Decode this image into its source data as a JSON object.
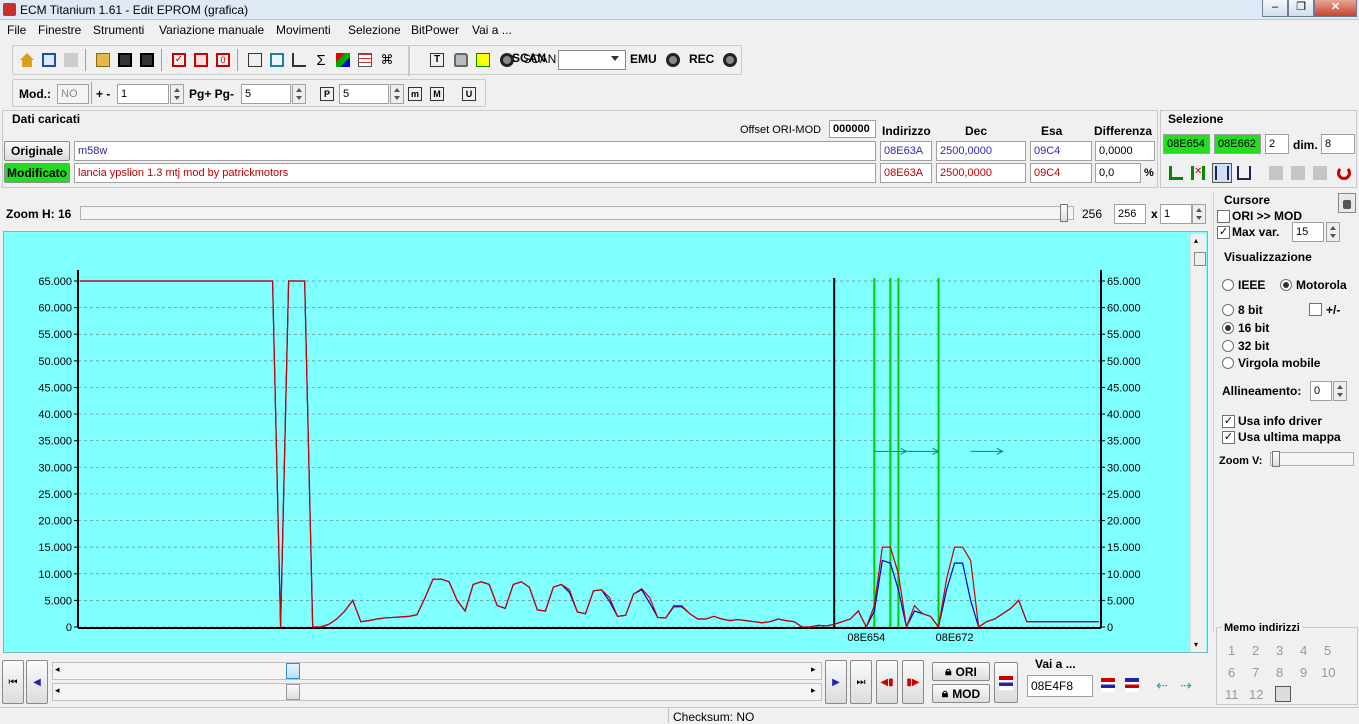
{
  "window": {
    "title": "ECM Titanium 1.61 - Edit EPROM (grafica)"
  },
  "menu": [
    "File",
    "Finestre",
    "Strumenti",
    "Variazione manuale",
    "Movimenti",
    "Selezione",
    "BitPower",
    "Vai a ..."
  ],
  "toolbar1": {
    "scan_label": "SCAN",
    "scan_value": "",
    "emu_label": "EMU",
    "rec_label": "REC"
  },
  "toolbar2": {
    "mod_label": "Mod.:",
    "mod_value": "NO",
    "plusminus_label": "+ -",
    "plusminus_value": "1",
    "pg_label": "Pg+ Pg-",
    "pg_value": "5",
    "p_value": "5"
  },
  "dati": {
    "title": "Dati caricati",
    "offset_label": "Offset ORI-MOD",
    "offset_value": "000000",
    "col_indirizzo": "Indirizzo",
    "col_dec": "Dec",
    "col_esa": "Esa",
    "col_diff": "Differenza",
    "originale_label": "Originale",
    "originale_name": "m58w",
    "originale_addr": "08E63A",
    "originale_dec": "2500,0000",
    "originale_esa": "09C4",
    "originale_diff": "0,0000",
    "modificato_label": "Modificato",
    "modificato_name": "lancia ypslion 1.3 mtj mod by patrickmotors",
    "modificato_addr": "08E63A",
    "modificato_dec": "2500,0000",
    "modificato_esa": "09C4",
    "modificato_diff": "0,0",
    "percent": "%"
  },
  "selezione": {
    "title": "Selezione",
    "start": "08E654",
    "end": "08E662",
    "count": "2",
    "dim_label": "dim.",
    "dim_value": "8"
  },
  "zoom": {
    "label": "Zoom H: 16",
    "value_a": "256",
    "value_b": "256",
    "x_label": "x",
    "mult": "1",
    "slider_fraction": 0.995
  },
  "cursore": {
    "title": "Cursore",
    "ori_mod_label": "ORI >> MOD",
    "ori_mod_checked": false,
    "maxvar_label": "Max var.",
    "maxvar_checked": true,
    "maxvar_value": "15"
  },
  "visualizzazione": {
    "title": "Visualizzazione",
    "ieee": "IEEE",
    "motorola": "Motorola",
    "bit8": "8 bit",
    "bit16": "16 bit",
    "bit32": "32 bit",
    "virgola": "Virgola mobile",
    "plusminus": "+/-",
    "allineamento_label": "Allineamento:",
    "allineamento_value": "0",
    "usa_info_driver": "Usa info driver",
    "usa_ultima_mappa": "Usa ultima mappa",
    "zoomv_label": "Zoom V:"
  },
  "memo": {
    "title": "Memo indirizzi",
    "numbers": [
      "1",
      "2",
      "3",
      "4",
      "5",
      "6",
      "7",
      "8",
      "9",
      "10",
      "11",
      "12"
    ]
  },
  "bottom": {
    "ori_label": "ORI",
    "mod_label": "MOD",
    "vaia_label": "Vai a ...",
    "vaia_value": "08E4F8",
    "scroll_fraction": 0.296
  },
  "status": {
    "checksum": "Checksum: NO"
  },
  "chart_data": {
    "type": "line",
    "ylim": [
      0,
      65000
    ],
    "yticks": [
      "0",
      "5.000",
      "10.000",
      "15.000",
      "20.000",
      "25.000",
      "30.000",
      "35.000",
      "40.000",
      "45.000",
      "50.000",
      "55.000",
      "60.000",
      "65.000"
    ],
    "xtick_labels": [
      {
        "index": 98,
        "label": "08E654"
      },
      {
        "index": 109,
        "label": "08E672"
      }
    ],
    "colors": {
      "background": "#80ffff",
      "modified": "#cc0000",
      "original": "#0000cc",
      "cursor": "#000000",
      "selection": "#00cc00",
      "arrows": "#008888"
    },
    "x_count": 128,
    "modified": [
      65000,
      65000,
      65000,
      65000,
      65000,
      65000,
      65000,
      65000,
      65000,
      65000,
      65000,
      65000,
      65000,
      65000,
      65000,
      65000,
      65000,
      65000,
      65000,
      65000,
      65000,
      65000,
      65000,
      65000,
      65000,
      0,
      65000,
      65000,
      65000,
      0,
      0,
      500,
      1500,
      3000,
      5000,
      1000,
      1200,
      1500,
      1700,
      1800,
      1900,
      2000,
      2300,
      5500,
      9000,
      9000,
      8500,
      5000,
      3000,
      8000,
      8500,
      8000,
      4000,
      3500,
      8000,
      8500,
      7500,
      3200,
      3000,
      7500,
      8000,
      7000,
      2800,
      2500,
      6800,
      7000,
      5500,
      2000,
      2200,
      6200,
      7200,
      5500,
      1800,
      1700,
      4000,
      4000,
      2500,
      1500,
      1500,
      2000,
      1500,
      1200,
      1400,
      1200,
      1000,
      800,
      1000,
      1500,
      1200,
      1000,
      0,
      0,
      300,
      200,
      500,
      1000,
      1500,
      3000,
      0,
      4000,
      15000,
      15000,
      10000,
      0,
      4000,
      2500,
      2000,
      0,
      9000,
      15000,
      15000,
      12500,
      0,
      1000,
      1500,
      2500,
      3500,
      5000,
      1000,
      1000,
      1000,
      1000,
      1000,
      1000,
      1000,
      1000,
      1000,
      1000
    ],
    "original": [
      65000,
      65000,
      65000,
      65000,
      65000,
      65000,
      65000,
      65000,
      65000,
      65000,
      65000,
      65000,
      65000,
      65000,
      65000,
      65000,
      65000,
      65000,
      65000,
      65000,
      65000,
      65000,
      65000,
      65000,
      65000,
      0,
      65000,
      65000,
      65000,
      0,
      0,
      500,
      1500,
      3000,
      5000,
      1000,
      1200,
      1500,
      1700,
      1800,
      1900,
      2000,
      2300,
      5500,
      9000,
      9000,
      8500,
      5000,
      3000,
      8000,
      8500,
      8000,
      4000,
      3500,
      8000,
      8500,
      7500,
      3200,
      3000,
      7500,
      8000,
      6500,
      2800,
      2500,
      6800,
      7000,
      4800,
      2000,
      2200,
      6200,
      7000,
      4500,
      1800,
      1700,
      3800,
      3800,
      2500,
      1500,
      1500,
      2000,
      1500,
      1200,
      1400,
      1200,
      1000,
      800,
      1000,
      1500,
      1200,
      1000,
      0,
      0,
      300,
      200,
      500,
      1000,
      1500,
      3000,
      0,
      3000,
      12500,
      12000,
      7000,
      0,
      3000,
      2500,
      2000,
      0,
      7000,
      12000,
      12000,
      5000,
      0,
      1000,
      1500,
      2500,
      3500,
      5000,
      1000,
      1000,
      1000,
      1000,
      1000,
      1000,
      1000,
      1000,
      1000,
      1000
    ],
    "cursor_index": 94,
    "selection_lines": [
      99,
      101,
      102,
      107
    ],
    "arrows": [
      {
        "from": 99,
        "to": 103
      },
      {
        "from": 103,
        "to": 107
      },
      {
        "from": 111,
        "to": 115
      }
    ]
  }
}
